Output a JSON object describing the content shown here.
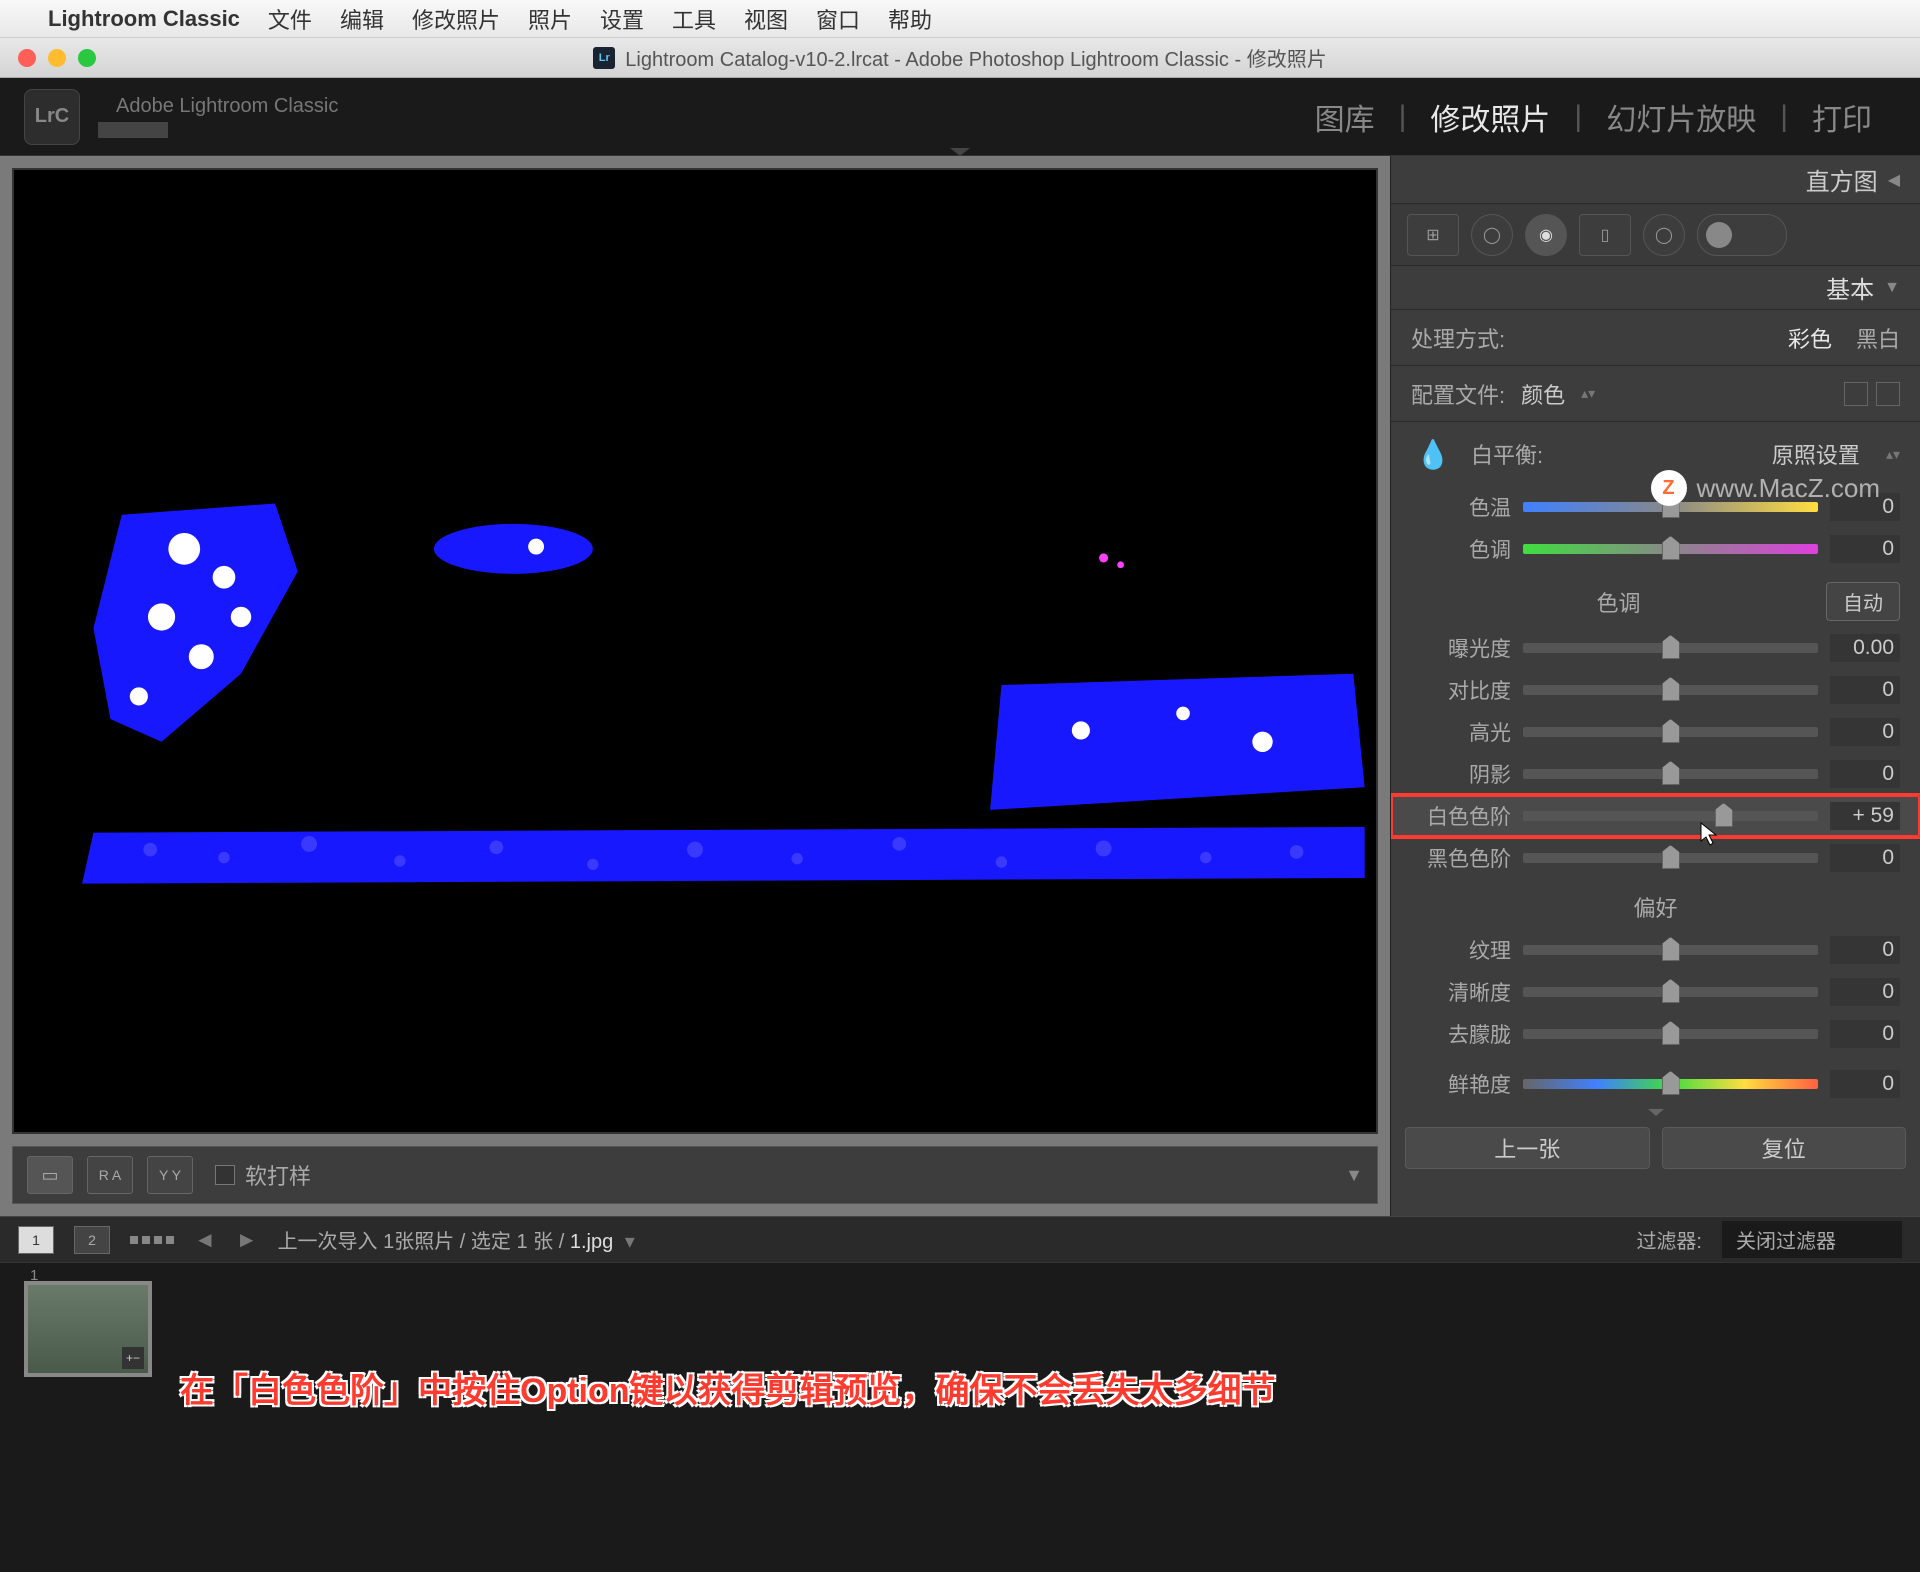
{
  "menubar": {
    "app": "Lightroom Classic",
    "items": [
      "文件",
      "编辑",
      "修改照片",
      "照片",
      "设置",
      "工具",
      "视图",
      "窗口",
      "帮助"
    ]
  },
  "window": {
    "title": "Lightroom Catalog-v10-2.lrcat - Adobe Photoshop Lightroom Classic - 修改照片"
  },
  "header": {
    "badge": "LrC",
    "brand": "Adobe Lightroom Classic",
    "modules": [
      "图库",
      "修改照片",
      "幻灯片放映",
      "打印"
    ],
    "active_module": 1
  },
  "canvas_toolbar": {
    "softproof": "软打样"
  },
  "right_panel": {
    "histogram": "直方图",
    "basic": "基本",
    "treatment": {
      "label": "处理方式:",
      "color": "彩色",
      "bw": "黑白"
    },
    "profile": {
      "label": "配置文件:",
      "value": "颜色"
    },
    "wb": {
      "label": "白平衡:",
      "preset": "原照设置"
    },
    "sliders": {
      "temp": {
        "label": "色温",
        "value": "0",
        "pos": 50
      },
      "tint": {
        "label": "色调",
        "value": "0",
        "pos": 50
      },
      "tone_header": "色调",
      "auto": "自动",
      "exposure": {
        "label": "曝光度",
        "value": "0.00",
        "pos": 50
      },
      "contrast": {
        "label": "对比度",
        "value": "0",
        "pos": 50
      },
      "highlights": {
        "label": "高光",
        "value": "0",
        "pos": 50
      },
      "shadows": {
        "label": "阴影",
        "value": "0",
        "pos": 50
      },
      "whites": {
        "label": "白色色阶",
        "value": "+ 59",
        "pos": 68
      },
      "blacks": {
        "label": "黑色色阶",
        "value": "0",
        "pos": 50
      },
      "presence_header": "偏好",
      "texture": {
        "label": "纹理",
        "value": "0",
        "pos": 50
      },
      "clarity": {
        "label": "清晰度",
        "value": "0",
        "pos": 50
      },
      "dehaze": {
        "label": "去朦胧",
        "value": "0",
        "pos": 50
      },
      "vibrance": {
        "label": "鲜艳度",
        "value": "0",
        "pos": 50
      }
    },
    "nav": {
      "prev": "上一张",
      "reset": "复位"
    }
  },
  "filmstrip_header": {
    "views": [
      "1",
      "2"
    ],
    "breadcrumb": "上一次导入   1张照片 / 选定 1 张 /",
    "filename": "1.jpg",
    "filter_label": "过滤器:",
    "filter_value": "关闭过滤器"
  },
  "filmstrip": {
    "thumb_num": "1"
  },
  "annotation": "在「白色色阶」中按住Option键以获得剪辑预览，确保不会丢失太多细节",
  "watermark": "www.MacZ.com"
}
